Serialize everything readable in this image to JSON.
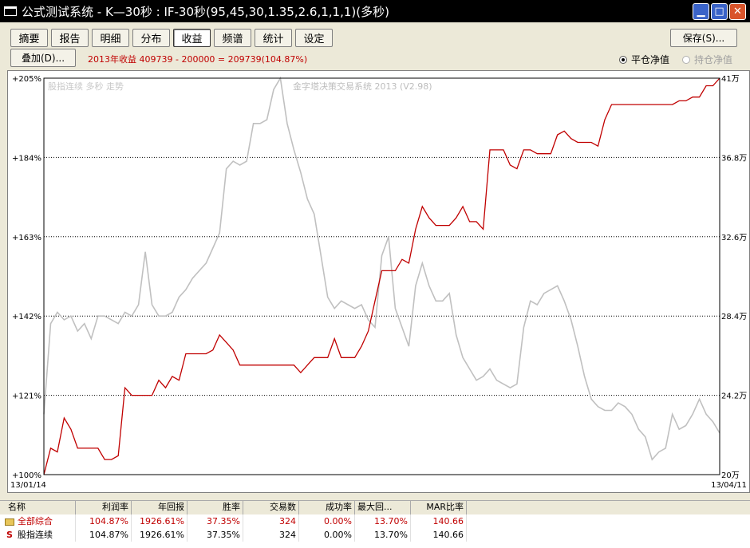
{
  "window": {
    "title": "公式测试系统 - K—30秒 : IF-30秒(95,45,30,1.35,2.6,1,1,1)(多秒)"
  },
  "tabs": [
    "摘要",
    "报告",
    "明细",
    "分布",
    "收益",
    "频谱",
    "统计",
    "设定"
  ],
  "active_tab": 4,
  "toolbar": {
    "save_label": "保存(S)...",
    "overlay_label": "叠加(D)...",
    "summary_text": "2013年收益 409739 - 200000 = 209739(104.87%)",
    "radio_close": "平仓净值",
    "radio_hold": "持仓净值"
  },
  "chart_data": {
    "type": "line",
    "watermark_left": "股指连续 多秒 走势",
    "watermark_center": "金字塔决策交易系统 2013 (V2.98)",
    "x_start_label": "13/01/14",
    "x_end_label": "13/04/11",
    "y_left_ticks": [
      "+205%",
      "+184%",
      "+163%",
      "+142%",
      "+121%",
      "+100%"
    ],
    "y_left_values": [
      205,
      184,
      163,
      142,
      121,
      100
    ],
    "y_right_ticks": [
      "41万",
      "36.8万",
      "32.6万",
      "28.4万",
      "24.2万",
      "20万"
    ],
    "y_right_values": [
      41,
      36.8,
      32.6,
      28.4,
      24.2,
      20
    ],
    "ylim_left": [
      100,
      205
    ],
    "grid": true,
    "series": [
      {
        "color": "#c00000",
        "x": [
          0,
          1,
          2,
          3,
          4,
          5,
          6,
          7,
          8,
          9,
          10,
          11,
          12,
          13,
          14,
          15,
          16,
          17,
          18,
          19,
          20,
          21,
          22,
          23,
          24,
          25,
          26,
          27,
          28,
          29,
          30,
          31,
          32,
          33,
          34,
          35,
          36,
          37,
          38,
          39,
          40,
          41,
          42,
          43,
          44,
          45,
          46,
          47,
          48,
          49,
          50,
          51,
          52,
          53,
          54,
          55,
          56,
          57,
          58,
          59,
          60,
          61,
          62,
          63,
          64,
          65,
          66,
          67,
          68,
          69,
          70,
          71,
          72,
          73,
          74,
          75,
          76,
          77,
          78,
          79,
          80,
          81,
          82,
          83,
          84,
          85,
          86,
          87,
          88,
          89,
          90,
          91,
          92,
          93,
          94,
          95,
          96,
          97,
          98,
          99,
          100
        ],
        "values": [
          100,
          107,
          106,
          115,
          112,
          107,
          107,
          107,
          107,
          104,
          104,
          105,
          123,
          121,
          121,
          121,
          121,
          125,
          123,
          126,
          125,
          132,
          132,
          132,
          132,
          133,
          137,
          135,
          133,
          129,
          129,
          129,
          129,
          129,
          129,
          129,
          129,
          129,
          127,
          129,
          131,
          131,
          131,
          136,
          131,
          131,
          131,
          134,
          138,
          146,
          154,
          154,
          154,
          157,
          156,
          165,
          171,
          168,
          166,
          166,
          166,
          168,
          171,
          167,
          167,
          165,
          186,
          186,
          186,
          182,
          181,
          186,
          186,
          185,
          185,
          185,
          190,
          191,
          189,
          188,
          188,
          188,
          187,
          194,
          198,
          198,
          198,
          198,
          198,
          198,
          198,
          198,
          198,
          198,
          199,
          199,
          200,
          200,
          203,
          203,
          205
        ]
      },
      {
        "color": "#c0c0c0",
        "x": [
          0,
          1,
          2,
          3,
          4,
          5,
          6,
          7,
          8,
          9,
          10,
          11,
          12,
          13,
          14,
          15,
          16,
          17,
          18,
          19,
          20,
          21,
          22,
          23,
          24,
          25,
          26,
          27,
          28,
          29,
          30,
          31,
          32,
          33,
          34,
          35,
          36,
          37,
          38,
          39,
          40,
          41,
          42,
          43,
          44,
          45,
          46,
          47,
          48,
          49,
          50,
          51,
          52,
          53,
          54,
          55,
          56,
          57,
          58,
          59,
          60,
          61,
          62,
          63,
          64,
          65,
          66,
          67,
          68,
          69,
          70,
          71,
          72,
          73,
          74,
          75,
          76,
          77,
          78,
          79,
          80,
          81,
          82,
          83,
          84,
          85,
          86,
          87,
          88,
          89,
          90,
          91,
          92,
          93,
          94,
          95,
          96,
          97,
          98,
          99,
          100
        ],
        "values": [
          116,
          140,
          143,
          141,
          142,
          138,
          140,
          136,
          142,
          142,
          141,
          140,
          143,
          142,
          145,
          159,
          145,
          142,
          142,
          143,
          147,
          149,
          152,
          154,
          156,
          160,
          164,
          181,
          183,
          182,
          183,
          193,
          193,
          194,
          202,
          205,
          193,
          186,
          180,
          173,
          169,
          158,
          147,
          144,
          146,
          145,
          144,
          145,
          141,
          139,
          158,
          163,
          144,
          139,
          134,
          150,
          156,
          150,
          146,
          146,
          148,
          137,
          131,
          128,
          125,
          126,
          128,
          125,
          124,
          123,
          124,
          139,
          146,
          145,
          148,
          149,
          150,
          146,
          141,
          134,
          126,
          120,
          118,
          117,
          117,
          119,
          118,
          116,
          112,
          110,
          104,
          106,
          107,
          116,
          112,
          113,
          116,
          120,
          116,
          114,
          111
        ]
      }
    ]
  },
  "grid": {
    "headers": [
      "名称",
      "利润率",
      "年回报",
      "胜率",
      "交易数",
      "成功率",
      "最大回...",
      "MAR比率"
    ],
    "rows": [
      [
        "全部综合",
        "104.87%",
        "1926.61%",
        "37.35%",
        "324",
        "0.00%",
        "13.70%",
        "140.66"
      ],
      [
        "股指连续",
        "104.87%",
        "1926.61%",
        "37.35%",
        "324",
        "0.00%",
        "13.70%",
        "140.66"
      ]
    ]
  }
}
